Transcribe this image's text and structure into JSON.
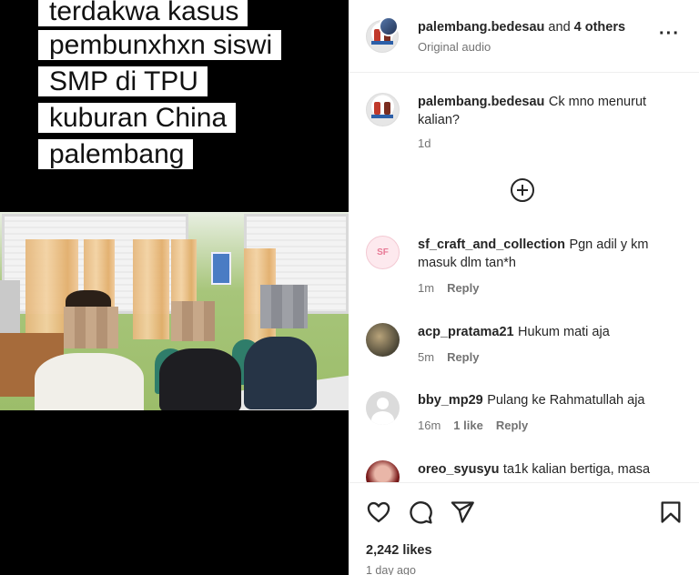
{
  "video": {
    "caption_lines": [
      "terdakwa kasus",
      "pembunxhxn siswi",
      "SMP di TPU",
      "kuburan China",
      "palembang"
    ]
  },
  "header": {
    "username": "palembang.bedesau",
    "and_text": " and ",
    "others": "4 others",
    "audio": "Original audio",
    "more_icon": "more-horizontal-icon"
  },
  "caption_comment": {
    "username": "palembang.bedesau",
    "text": "Ck mno menurut kalian?",
    "time": "1d"
  },
  "load_more_icon": "plus-circle-icon",
  "comments": [
    {
      "avatar_text": "SF",
      "username": "sf_craft_and_collection",
      "text": "Pgn adil y km masuk dlm tan*h",
      "time": "1m",
      "likes": "",
      "reply": "Reply"
    },
    {
      "avatar_text": "",
      "username": "acp_pratama21",
      "text": "Hukum mati aja",
      "time": "5m",
      "likes": "",
      "reply": "Reply"
    },
    {
      "avatar_text": "",
      "username": "bby_mp29",
      "text": "Pulang ke Rahmatullah aja",
      "time": "16m",
      "likes": "1 like",
      "reply": "Reply"
    },
    {
      "avatar_text": "",
      "username": "oreo_syusyu",
      "text": "ta1k kalian bertiga, masa",
      "time": "",
      "likes": "",
      "reply": ""
    }
  ],
  "actions": {
    "icons": [
      "heart-icon",
      "comment-icon",
      "share-icon",
      "bookmark-icon"
    ],
    "likes": "2,242 likes",
    "time": "1 day ago"
  },
  "colors": {
    "text": "#262626",
    "muted": "#737373",
    "divider": "#efefef"
  }
}
